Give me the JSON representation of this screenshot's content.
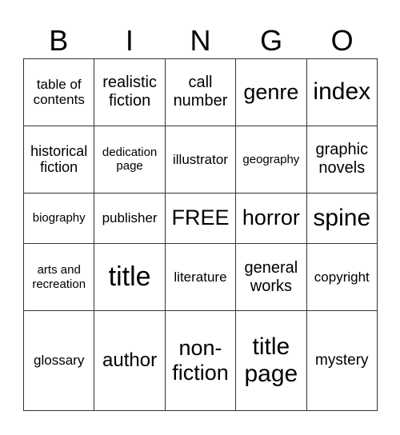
{
  "header": [
    "B",
    "I",
    "N",
    "G",
    "O"
  ],
  "cells": [
    [
      {
        "t": "table of contents",
        "s": 17
      },
      {
        "t": "realistic fiction",
        "s": 20
      },
      {
        "t": "call number",
        "s": 20
      },
      {
        "t": "genre",
        "s": 27
      },
      {
        "t": "index",
        "s": 30
      }
    ],
    [
      {
        "t": "historical fiction",
        "s": 18
      },
      {
        "t": "dedication page",
        "s": 15
      },
      {
        "t": "illustrator",
        "s": 17
      },
      {
        "t": "geography",
        "s": 15
      },
      {
        "t": "graphic novels",
        "s": 20
      }
    ],
    [
      {
        "t": "biography",
        "s": 15
      },
      {
        "t": "publisher",
        "s": 17
      },
      {
        "t": "FREE",
        "s": 27
      },
      {
        "t": "horror",
        "s": 27
      },
      {
        "t": "spine",
        "s": 30
      }
    ],
    [
      {
        "t": "arts and recreation",
        "s": 15
      },
      {
        "t": "title",
        "s": 34
      },
      {
        "t": "literature",
        "s": 17
      },
      {
        "t": "general works",
        "s": 20
      },
      {
        "t": "copyright",
        "s": 17
      }
    ],
    [
      {
        "t": "glossary",
        "s": 17
      },
      {
        "t": "author",
        "s": 24
      },
      {
        "t": "non-fiction",
        "s": 27
      },
      {
        "t": "title page",
        "s": 30
      },
      {
        "t": "mystery",
        "s": 19
      }
    ]
  ]
}
